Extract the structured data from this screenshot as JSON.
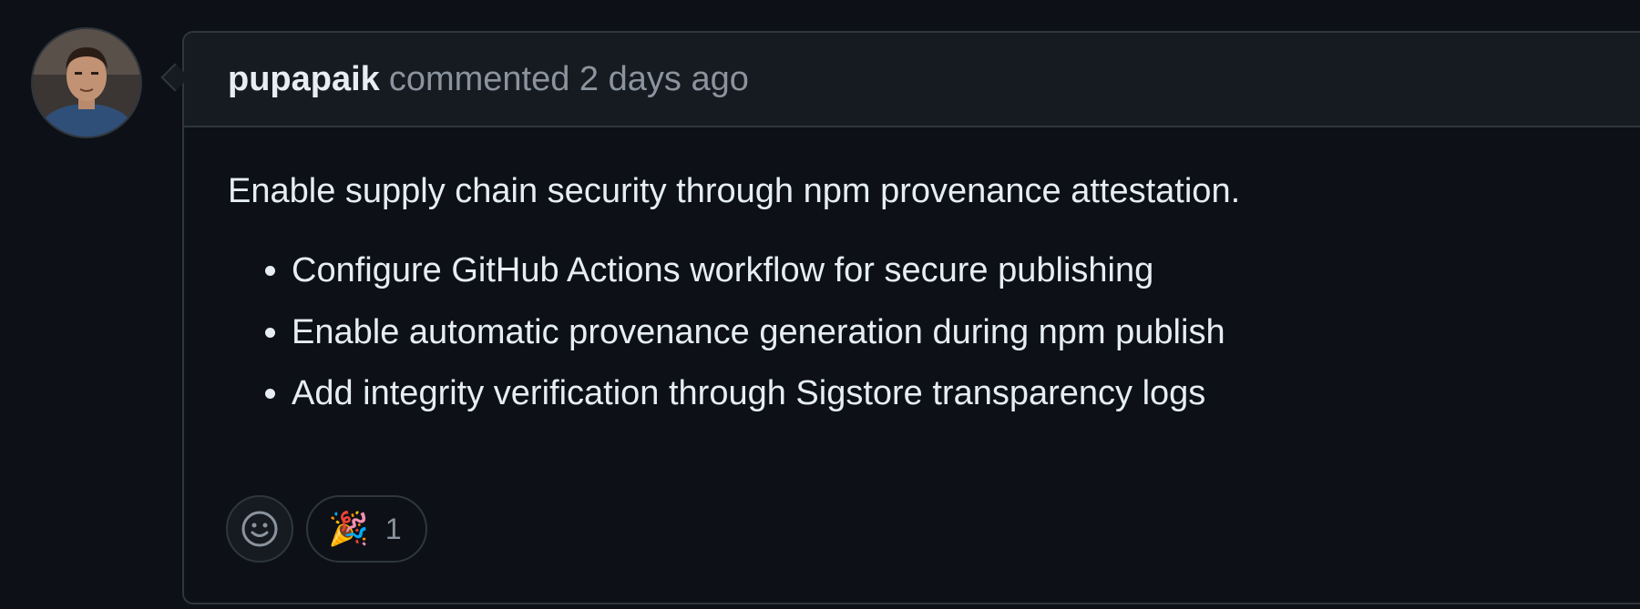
{
  "comment": {
    "author": "pupapaik",
    "action": "commented",
    "timestamp": "2 days ago",
    "body": {
      "intro": "Enable supply chain security through npm provenance attestation.",
      "bullets": [
        "Configure GitHub Actions workflow for secure publishing",
        "Enable automatic provenance generation during npm publish",
        "Add integrity verification through Sigstore transparency logs"
      ]
    },
    "reactions": {
      "picker_icon": "smiley-icon",
      "items": [
        {
          "emoji": "🎉",
          "icon": "party-popper-icon",
          "count": "1"
        }
      ]
    }
  },
  "colors": {
    "background": "#0d1117",
    "header_background": "#161b22",
    "border": "#30363d",
    "text": "#e6edf3",
    "muted_text": "#8b949e"
  }
}
